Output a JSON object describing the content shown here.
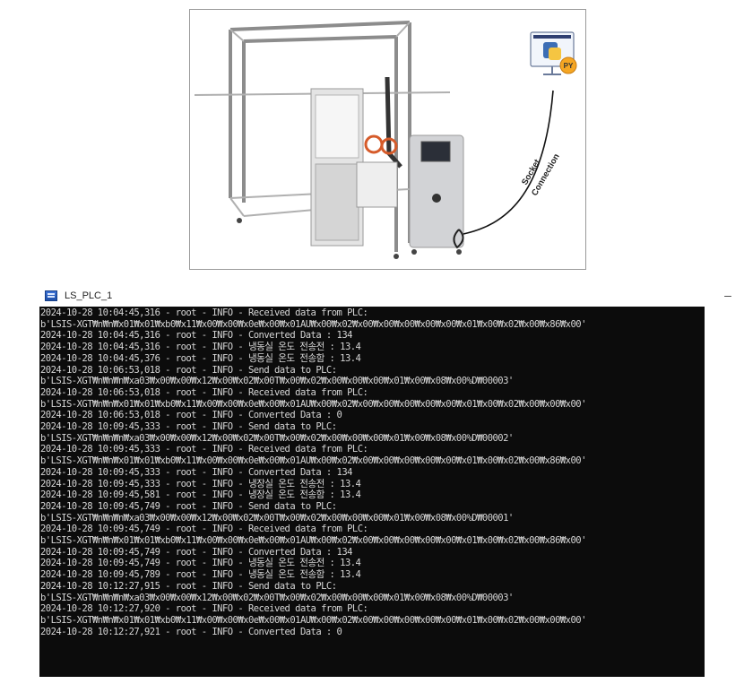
{
  "photo": {
    "connection_label_1": "Socket",
    "connection_label_2": "Connection",
    "python_badge": "PY",
    "icon": "python-monitor-icon"
  },
  "window": {
    "title": "LS_PLC_1",
    "minimize_label": "–",
    "icon": "app-window-icon"
  },
  "console": {
    "lines": [
      "2024-10-28 10:04:45,316 - root - INFO - Received data from PLC:",
      "b'LSIS-XGT₩n₩n₩x01₩x01₩xb0₩x11₩x00₩x00₩x0e₩x00₩x01AU₩x00₩x02₩x00₩x00₩x00₩x00₩x00₩x01₩x00₩x02₩x00₩x86₩x00'",
      "2024-10-28 10:04:45,316 - root - INFO - Converted Data : 134",
      "2024-10-28 10:04:45,316 - root - INFO - 냉동실 온도 전송전 : 13.4",
      "2024-10-28 10:04:45,376 - root - INFO - 냉동실 온도 전송함 : 13.4",
      "2024-10-28 10:06:53,018 - root - INFO - Send data to PLC:",
      "b'LSIS-XGT₩n₩n₩n₩xa03₩x00₩x00₩x12₩x00₩x02₩x00T₩x00₩x02₩x00₩x00₩x00₩x01₩x00₩x08₩x00%D₩00003'",
      "2024-10-28 10:06:53,018 - root - INFO - Received data from PLC:",
      "b'LSIS-XGT₩n₩n₩x01₩x01₩xb0₩x11₩x00₩x00₩x0e₩x00₩x01AU₩x00₩x02₩x00₩x00₩x00₩x00₩x00₩x01₩x00₩x02₩x00₩x00₩x00'",
      "2024-10-28 10:06:53,018 - root - INFO - Converted Data : 0",
      "2024-10-28 10:09:45,333 - root - INFO - Send data to PLC:",
      "b'LSIS-XGT₩n₩n₩n₩xa03₩x00₩x00₩x12₩x00₩x02₩x00T₩x00₩x02₩x00₩x00₩x00₩x01₩x00₩x08₩x00%D₩00002'",
      "2024-10-28 10:09:45,333 - root - INFO - Received data from PLC:",
      "b'LSIS-XGT₩n₩n₩x01₩x01₩xb0₩x11₩x00₩x00₩x0e₩x00₩x01AU₩x00₩x02₩x00₩x00₩x00₩x00₩x00₩x01₩x00₩x02₩x00₩x86₩x00'",
      "2024-10-28 10:09:45,333 - root - INFO - Converted Data : 134",
      "2024-10-28 10:09:45,333 - root - INFO - 냉장실 온도 전송전 : 13.4",
      "2024-10-28 10:09:45,581 - root - INFO - 냉장실 온도 전송함 : 13.4",
      "2024-10-28 10:09:45,749 - root - INFO - Send data to PLC:",
      "b'LSIS-XGT₩n₩n₩n₩xa03₩x00₩x00₩x12₩x00₩x02₩x00T₩x00₩x02₩x00₩x00₩x00₩x01₩x00₩x08₩x00%D₩00001'",
      "2024-10-28 10:09:45,749 - root - INFO - Received data from PLC:",
      "b'LSIS-XGT₩n₩n₩x01₩x01₩xb0₩x11₩x00₩x00₩x0e₩x00₩x01AU₩x00₩x02₩x00₩x00₩x00₩x00₩x00₩x01₩x00₩x02₩x00₩x86₩x00'",
      "2024-10-28 10:09:45,749 - root - INFO - Converted Data : 134",
      "2024-10-28 10:09:45,749 - root - INFO - 냉동실 온도 전송전 : 13.4",
      "2024-10-28 10:09:45,789 - root - INFO - 냉동실 온도 전송함 : 13.4",
      "2024-10-28 10:12:27,915 - root - INFO - Send data to PLC:",
      "b'LSIS-XGT₩n₩n₩n₩xa03₩x00₩x00₩x12₩x00₩x02₩x00T₩x00₩x02₩x00₩x00₩x00₩x01₩x00₩x08₩x00%D₩00003'",
      "2024-10-28 10:12:27,920 - root - INFO - Received data from PLC:",
      "b'LSIS-XGT₩n₩n₩x01₩x01₩xb0₩x11₩x00₩x00₩x0e₩x00₩x01AU₩x00₩x02₩x00₩x00₩x00₩x00₩x00₩x01₩x00₩x02₩x00₩x00₩x00'",
      "2024-10-28 10:12:27,921 - root - INFO - Converted Data : 0"
    ]
  }
}
